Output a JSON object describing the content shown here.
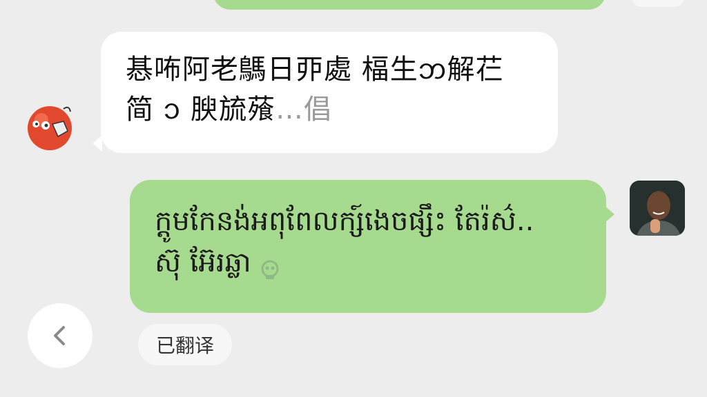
{
  "chat": {
    "incoming_message": {
      "text": "惎咘阿老鷌日丣處 楅生𑄃解芢\n简 𑄘 腴旈蕵",
      "faded_suffix": "…倡"
    },
    "outgoing_message": {
      "text": "ក្ដូមកែនង់អពុពែលក្ស៍ងេចផ្សឹះ តែរ៉ស៌..\nស៊ុ អ៊ែរឆ្លា"
    },
    "translated_label": "已翻译"
  },
  "colors": {
    "background": "#ededed",
    "outgoing_bubble": "#a6db8f",
    "incoming_bubble": "#ffffff"
  },
  "icons": {
    "back": "chevron-left-icon",
    "translate": "translate-icon"
  }
}
